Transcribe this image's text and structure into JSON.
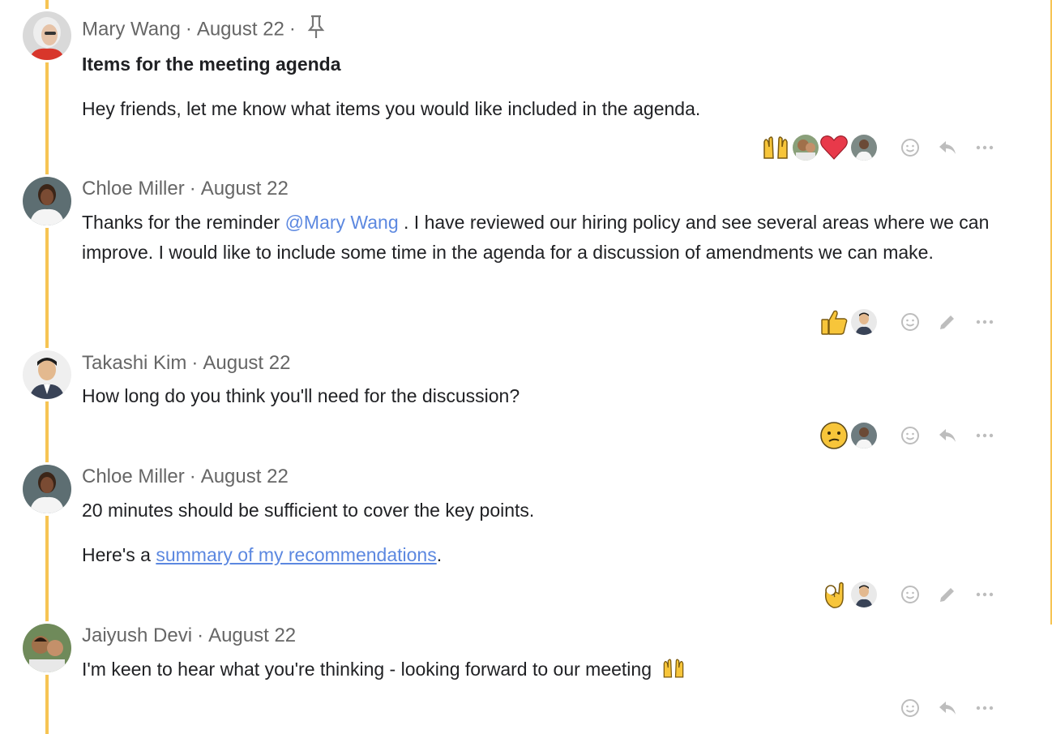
{
  "messages": [
    {
      "author": "Mary Wang",
      "date": "August 22",
      "pinned": true,
      "subject": "Items for the meeting agenda",
      "body": [
        "Hey friends, let me know what items you would like included in the agenda."
      ],
      "reactions": [
        "raising-hands",
        "heart"
      ],
      "actions": [
        "emoji",
        "reply",
        "more"
      ]
    },
    {
      "author": "Chloe Miller",
      "date": "August 22",
      "body_prefix": "Thanks for the reminder ",
      "mention": "@Mary Wang",
      "body_suffix": " . I have reviewed our hiring policy and see several areas where we can improve. I would like to include some time in the agenda for a discussion of amendments we can make.",
      "reactions": [
        "thumbs-up"
      ],
      "actions": [
        "emoji",
        "edit",
        "more"
      ]
    },
    {
      "author": "Takashi Kim",
      "date": "August 22",
      "body": [
        "How long do you think you'll need for the discussion?"
      ],
      "reactions": [
        "confused-face"
      ],
      "actions": [
        "emoji",
        "reply",
        "more"
      ]
    },
    {
      "author": "Chloe Miller",
      "date": "August 22",
      "body": [
        "20 minutes should be sufficient to cover the key points."
      ],
      "link_prefix": "Here's a ",
      "link_text": "summary of my recommendations",
      "link_suffix": ".",
      "reactions": [
        "ok-hand"
      ],
      "actions": [
        "emoji",
        "edit",
        "more"
      ]
    },
    {
      "author": "Jaiyush Devi",
      "date": "August 22",
      "body": [
        "I'm keen to hear what you're thinking - looking forward to our meeting"
      ],
      "reactions": [],
      "actions": [
        "emoji",
        "reply",
        "more"
      ]
    }
  ],
  "separator": "·",
  "colors": {
    "thread_line": "#f6c453",
    "link": "#5c88e0",
    "meta": "#666666",
    "icon": "#bdbdbd"
  }
}
